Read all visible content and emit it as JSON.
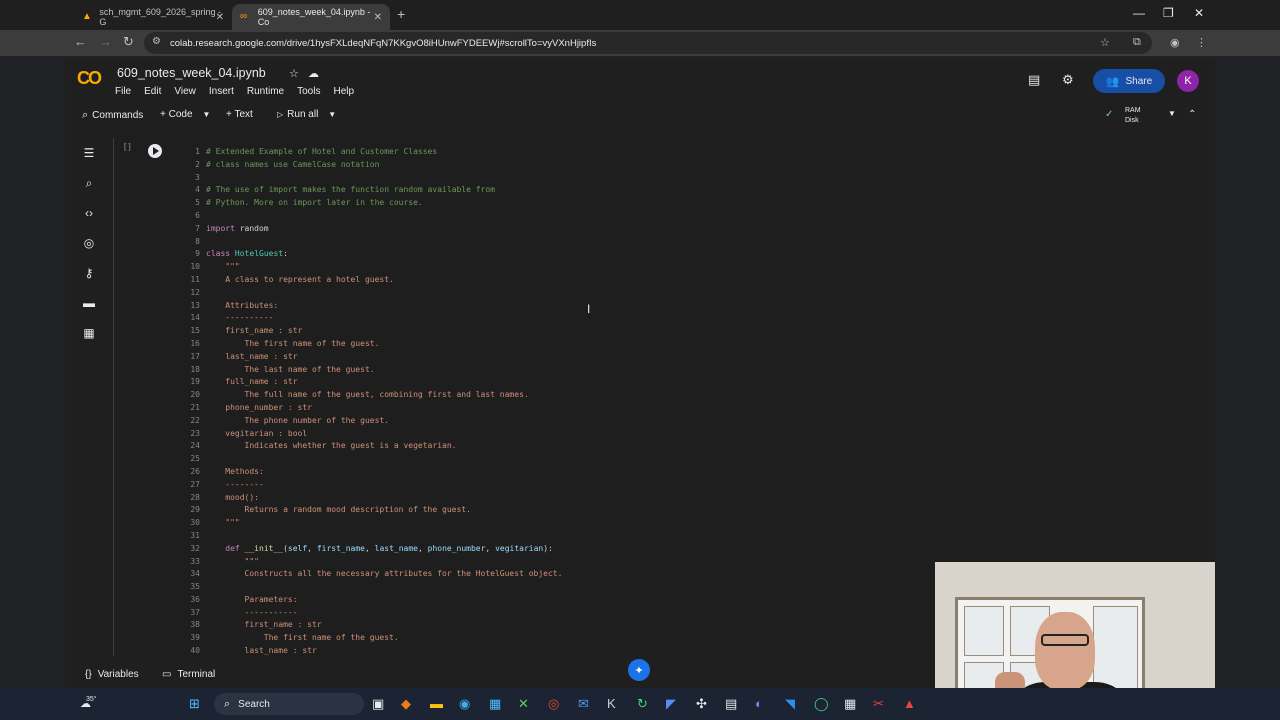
{
  "browser": {
    "tabs": [
      {
        "label": "sch_mgmt_609_2026_spring - G"
      },
      {
        "label": "609_notes_week_04.ipynb - Co"
      }
    ],
    "url": "colab.research.google.com/drive/1hysFXLdeqNFqN7KKgvO8iHUnwFYDEEWj#scrollTo=vyVXnHjipfIs"
  },
  "colab": {
    "title": "609_notes_week_04.ipynb",
    "menu": [
      "File",
      "Edit",
      "View",
      "Insert",
      "Runtime",
      "Tools",
      "Help"
    ],
    "share_label": "Share",
    "avatar_letter": "K",
    "toolbar": {
      "commands": "Commands",
      "code": "+ Code",
      "text": "+ Text",
      "run_all": "Run all"
    },
    "resources": {
      "ram": "RAM",
      "disk": "Disk"
    },
    "cell_bracket": "[ ]",
    "bottom": {
      "variables": "Variables",
      "terminal": "Terminal"
    }
  },
  "code_lines": [
    {
      "n": "1",
      "parts": [
        {
          "c": "cm",
          "t": "# Extended Example of Hotel and Customer Classes"
        }
      ]
    },
    {
      "n": "2",
      "parts": [
        {
          "c": "cm",
          "t": "# class names use CamelCase notation"
        }
      ]
    },
    {
      "n": "3",
      "parts": []
    },
    {
      "n": "4",
      "parts": [
        {
          "c": "cm",
          "t": "# The use of import makes the function random available from"
        }
      ]
    },
    {
      "n": "5",
      "parts": [
        {
          "c": "cm",
          "t": "# Python. More on import later in the course."
        }
      ]
    },
    {
      "n": "6",
      "parts": []
    },
    {
      "n": "7",
      "parts": [
        {
          "c": "kw",
          "t": "import"
        },
        {
          "c": "tx",
          "t": " random"
        }
      ]
    },
    {
      "n": "8",
      "parts": []
    },
    {
      "n": "9",
      "parts": [
        {
          "c": "kw",
          "t": "class"
        },
        {
          "c": "tx",
          "t": " "
        },
        {
          "c": "cl",
          "t": "HotelGuest"
        },
        {
          "c": "tx",
          "t": ":"
        }
      ]
    },
    {
      "n": "10",
      "parts": [
        {
          "c": "st",
          "t": "    \"\"\""
        }
      ]
    },
    {
      "n": "11",
      "parts": [
        {
          "c": "st",
          "t": "    A class to represent a hotel guest."
        }
      ]
    },
    {
      "n": "12",
      "parts": []
    },
    {
      "n": "13",
      "parts": [
        {
          "c": "st",
          "t": "    Attributes:"
        }
      ]
    },
    {
      "n": "14",
      "parts": [
        {
          "c": "st",
          "t": "    ----------"
        }
      ]
    },
    {
      "n": "15",
      "parts": [
        {
          "c": "st",
          "t": "    first_name : str"
        }
      ]
    },
    {
      "n": "16",
      "parts": [
        {
          "c": "st",
          "t": "        The first name of the guest."
        }
      ]
    },
    {
      "n": "17",
      "parts": [
        {
          "c": "st",
          "t": "    last_name : str"
        }
      ]
    },
    {
      "n": "18",
      "parts": [
        {
          "c": "st",
          "t": "        The last name of the guest."
        }
      ]
    },
    {
      "n": "19",
      "parts": [
        {
          "c": "st",
          "t": "    full_name : str"
        }
      ]
    },
    {
      "n": "20",
      "parts": [
        {
          "c": "st",
          "t": "        The full name of the guest, combining first and last names."
        }
      ]
    },
    {
      "n": "21",
      "parts": [
        {
          "c": "st",
          "t": "    phone_number : str"
        }
      ]
    },
    {
      "n": "22",
      "parts": [
        {
          "c": "st",
          "t": "        The phone number of the guest."
        }
      ]
    },
    {
      "n": "23",
      "parts": [
        {
          "c": "st",
          "t": "    vegitarian : bool"
        }
      ]
    },
    {
      "n": "24",
      "parts": [
        {
          "c": "st",
          "t": "        Indicates whether the guest is a vegetarian."
        }
      ]
    },
    {
      "n": "25",
      "parts": []
    },
    {
      "n": "26",
      "parts": [
        {
          "c": "st",
          "t": "    Methods:"
        }
      ]
    },
    {
      "n": "27",
      "parts": [
        {
          "c": "st",
          "t": "    --------"
        }
      ]
    },
    {
      "n": "28",
      "parts": [
        {
          "c": "st",
          "t": "    mood():"
        }
      ]
    },
    {
      "n": "29",
      "parts": [
        {
          "c": "st",
          "t": "        Returns a random mood description of the guest."
        }
      ]
    },
    {
      "n": "30",
      "parts": [
        {
          "c": "st",
          "t": "    \"\"\""
        }
      ]
    },
    {
      "n": "31",
      "parts": []
    },
    {
      "n": "32",
      "parts": [
        {
          "c": "kw",
          "t": "    def"
        },
        {
          "c": "tx",
          "t": " "
        },
        {
          "c": "fn",
          "t": "__init__"
        },
        {
          "c": "tx",
          "t": "("
        },
        {
          "c": "pr",
          "t": "self"
        },
        {
          "c": "tx",
          "t": ", "
        },
        {
          "c": "pr",
          "t": "first_name"
        },
        {
          "c": "tx",
          "t": ", "
        },
        {
          "c": "pr",
          "t": "last_name"
        },
        {
          "c": "tx",
          "t": ", "
        },
        {
          "c": "pr",
          "t": "phone_number"
        },
        {
          "c": "tx",
          "t": ", "
        },
        {
          "c": "pr",
          "t": "vegitarian"
        },
        {
          "c": "tx",
          "t": "):"
        }
      ]
    },
    {
      "n": "33",
      "parts": [
        {
          "c": "st",
          "t": "        \"\"\""
        }
      ]
    },
    {
      "n": "34",
      "parts": [
        {
          "c": "st",
          "t": "        Constructs all the necessary attributes for the HotelGuest object."
        }
      ]
    },
    {
      "n": "35",
      "parts": []
    },
    {
      "n": "36",
      "parts": [
        {
          "c": "st",
          "t": "        Parameters:"
        }
      ]
    },
    {
      "n": "37",
      "parts": [
        {
          "c": "st",
          "t": "        -----------"
        }
      ]
    },
    {
      "n": "38",
      "parts": [
        {
          "c": "st",
          "t": "        first_name : str"
        }
      ]
    },
    {
      "n": "39",
      "parts": [
        {
          "c": "st",
          "t": "            The first name of the guest."
        }
      ]
    },
    {
      "n": "40",
      "parts": [
        {
          "c": "st",
          "t": "        last_name : str"
        }
      ]
    }
  ],
  "taskbar": {
    "search_label": "Search",
    "weather": "35°"
  },
  "colors": {
    "accent": "#f9ab00",
    "share_bg": "#174ea6",
    "avatar_bg": "#8e24aa"
  }
}
